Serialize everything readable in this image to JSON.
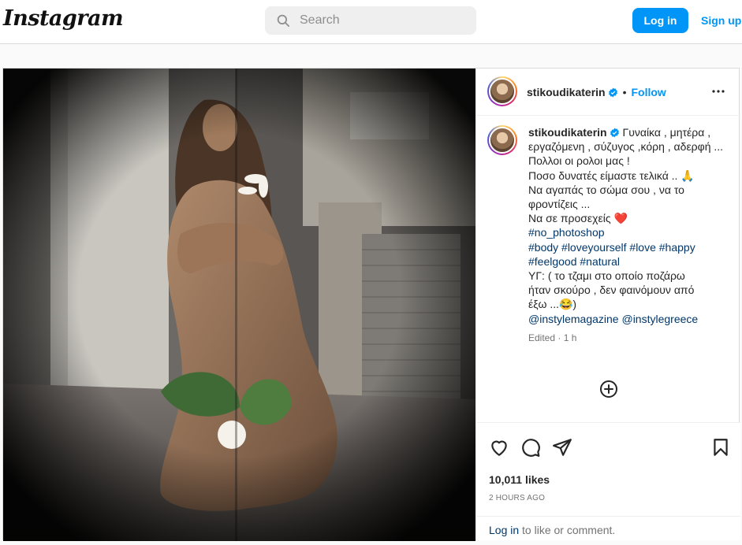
{
  "app": {
    "logo": "Instagram"
  },
  "search": {
    "placeholder": "Search",
    "icon": "search-icon"
  },
  "auth": {
    "login_label": "Log in",
    "signup_label": "Sign up"
  },
  "colors": {
    "accent": "#0095f6",
    "link_dark": "#00376b",
    "heart": "#ed1c24"
  },
  "post": {
    "username": "stikoudikaterin",
    "verified": true,
    "separator": "•",
    "follow_label": "Follow",
    "more_icon": "more-horizontal-icon",
    "caption": {
      "first": "Γυναίκα , μητέρα , εργαζόμενη , σύζυγος ,κόρη , αδερφή ...",
      "lines": [
        "Πολλοι οι ρολοι μας !",
        "Ποσο δυνατές είμαστε τελικά .. 🙏",
        "Να αγαπάς το σώμα σου , να το",
        "φροντίζεις ...",
        "Να σε προσεχείς"
      ],
      "heart_emoji": "❤️",
      "hashtags_1": "#no_photoshop",
      "hashtags_2": "#body #loveyourself #love #happy",
      "hashtags_3": "#feelgood #natural",
      "ps_lines": [
        "ΥΓ: ( το τζαμι στο οποίο ποζάρω",
        "ήταν σκούρο , δεν φαινόμουν από",
        "έξω ...😂)"
      ],
      "mentions": "@instylemagazine @instylegreece",
      "edited": "Edited · 1 h"
    },
    "likes": "10,011 likes",
    "time_ago": "2 HOURS AGO",
    "comment_prompt": {
      "link": "Log in",
      "rest": " to like or comment."
    }
  }
}
